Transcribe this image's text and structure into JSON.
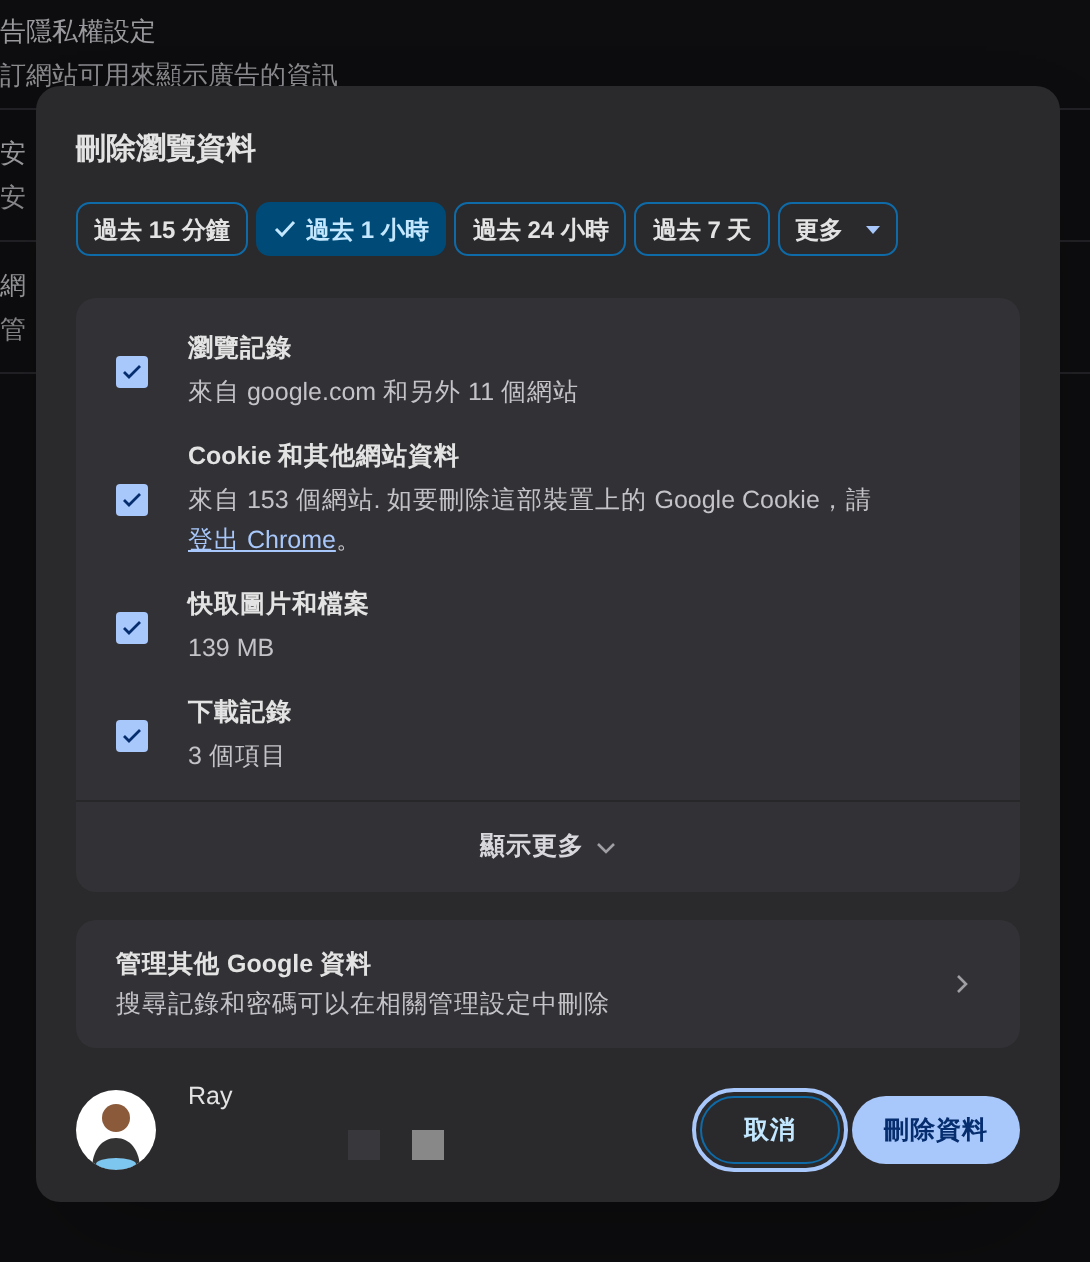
{
  "background_settings": [
    {
      "title": "告隱私權設定",
      "subtitle": "訂網站可用來顯示廣告的資訊"
    },
    {
      "title": "安",
      "subtitle": "安"
    },
    {
      "title": "網",
      "subtitle": "管"
    }
  ],
  "dialog": {
    "title": "刪除瀏覽資料",
    "time_ranges": [
      {
        "label": "過去 15 分鐘",
        "selected": false,
        "kind": "chip"
      },
      {
        "label": "過去 1 小時",
        "selected": true,
        "kind": "chip"
      },
      {
        "label": "過去 24 小時",
        "selected": false,
        "kind": "chip"
      },
      {
        "label": "過去 7 天",
        "selected": false,
        "kind": "chip"
      },
      {
        "label": "更多",
        "selected": false,
        "kind": "dropdown"
      }
    ],
    "items": [
      {
        "title": "瀏覽記錄",
        "detail": "來自 google.com 和另外 11 個網站",
        "checked": true
      },
      {
        "title": "Cookie 和其他網站資料",
        "detail": "來自 153 個網站. 如要刪除這部裝置上的 Google Cookie，請",
        "link": "登出 Chrome",
        "after_link": "。",
        "checked": true
      },
      {
        "title": "快取圖片和檔案",
        "detail": "139 MB",
        "checked": true
      },
      {
        "title": "下載記錄",
        "detail": "3 個項目",
        "checked": true
      }
    ],
    "show_more": "顯示更多",
    "manage": {
      "title": "管理其他 Google 資料",
      "subtitle": "搜尋記錄和密碼可以在相關管理設定中刪除"
    },
    "account": {
      "name": "Ray"
    },
    "buttons": [
      {
        "label": "取消",
        "kind": "secondary",
        "focused": true
      },
      {
        "label": "刪除資料",
        "kind": "primary",
        "focused": false
      }
    ]
  }
}
